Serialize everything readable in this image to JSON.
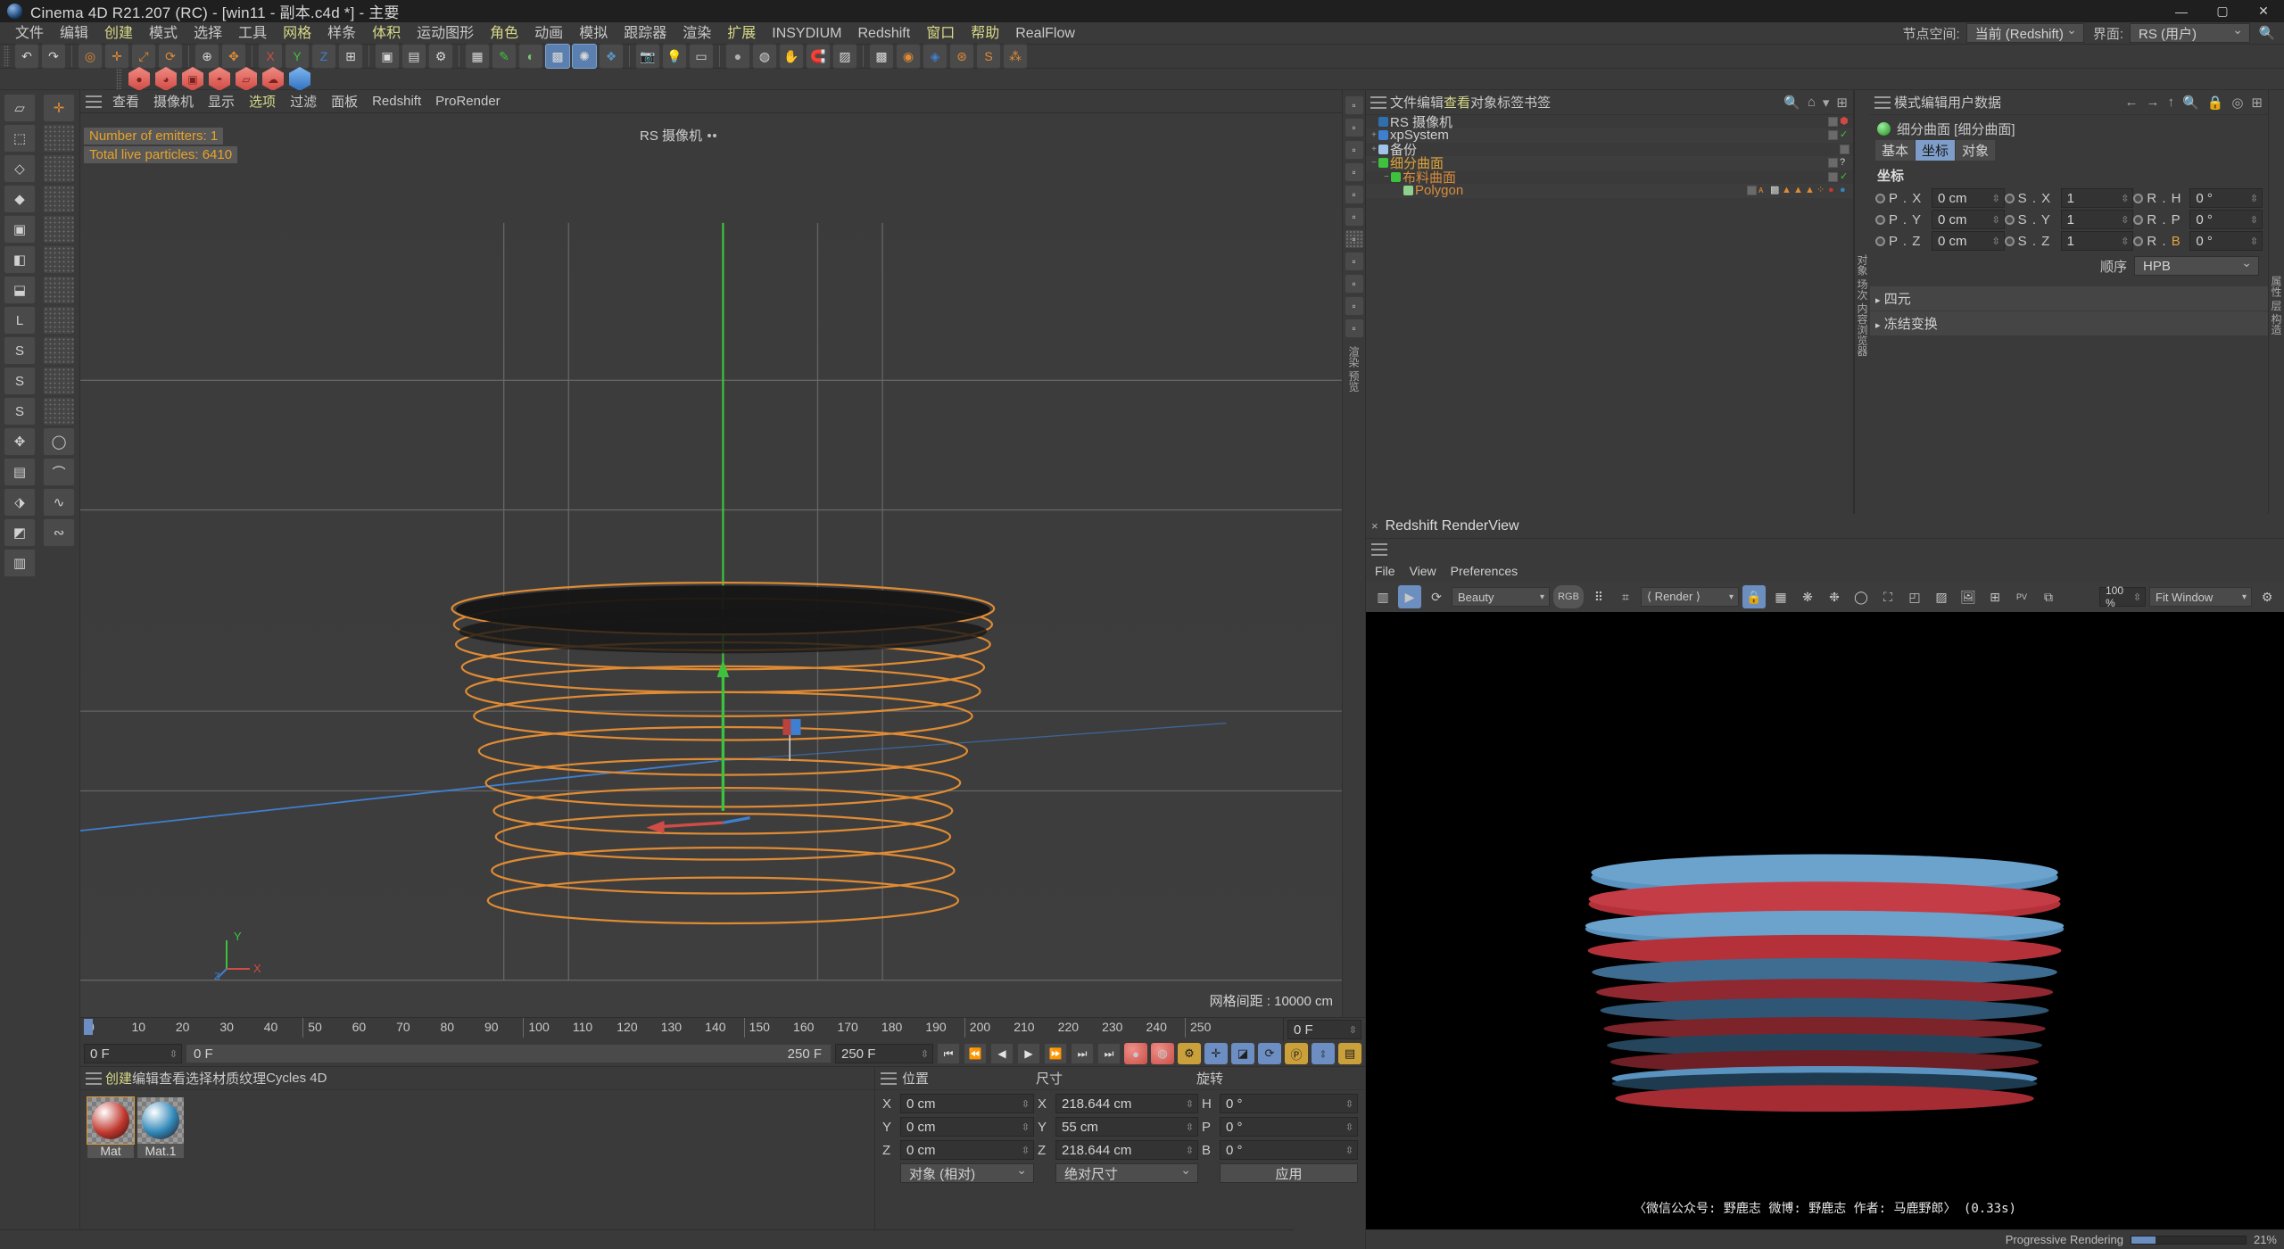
{
  "titlebar": {
    "title": "Cinema 4D R21.207 (RC) - [win11 - 副本.c4d *] - 主要",
    "minimize": "—",
    "maximize": "▢",
    "close": "✕"
  },
  "menubar": {
    "items": [
      {
        "label": "文件",
        "hl": false
      },
      {
        "label": "编辑",
        "hl": false
      },
      {
        "label": "创建",
        "hl": true
      },
      {
        "label": "模式",
        "hl": false
      },
      {
        "label": "选择",
        "hl": false
      },
      {
        "label": "工具",
        "hl": false
      },
      {
        "label": "网格",
        "hl": true
      },
      {
        "label": "样条",
        "hl": false
      },
      {
        "label": "体积",
        "hl": true
      },
      {
        "label": "运动图形",
        "hl": false
      },
      {
        "label": "角色",
        "hl": true
      },
      {
        "label": "动画",
        "hl": false
      },
      {
        "label": "模拟",
        "hl": false
      },
      {
        "label": "跟踪器",
        "hl": false
      },
      {
        "label": "渲染",
        "hl": false
      },
      {
        "label": "扩展",
        "hl": true
      },
      {
        "label": "INSYDIUM",
        "hl": false
      },
      {
        "label": "Redshift",
        "hl": false
      },
      {
        "label": "窗口",
        "hl": true
      },
      {
        "label": "帮助",
        "hl": true
      },
      {
        "label": "RealFlow",
        "hl": false
      }
    ],
    "nodespace_label": "节点空间:",
    "nodespace_value": "当前 (Redshift)",
    "interface_label": "界面:",
    "interface_value": "RS (用户)",
    "search_icon": "search-icon"
  },
  "viewport": {
    "menu": [
      "查看",
      "摄像机",
      "显示",
      "选项",
      "过滤",
      "面板",
      "Redshift",
      "ProRender"
    ],
    "menu_hl_index": 3,
    "camera_label": "RS 摄像机",
    "overlay": [
      "Number of emitters: 1",
      "Total live particles: 6410"
    ],
    "overlay_color": "#e8a22a",
    "grid_spacing": "网格间距 : 10000 cm",
    "axis_y": "Y",
    "axis_x": "X",
    "axis_z": "Z",
    "sidetext": "渲染 预览"
  },
  "timeline": {
    "ticks": [
      0,
      10,
      20,
      30,
      40,
      50,
      60,
      70,
      80,
      90,
      100,
      110,
      120,
      130,
      140,
      150,
      160,
      170,
      180,
      190,
      200,
      210,
      220,
      230,
      240,
      250
    ],
    "current_frame_field": "0 F",
    "current_frame_right": "0 F",
    "secondary_field": "0 F",
    "range_end_label": "250 F",
    "range_end_field": "250 F",
    "playback": [
      "goto-start",
      "prev-key",
      "prev-frame",
      "play",
      "next-frame",
      "next-key",
      "goto-end"
    ],
    "record_buttons": [
      "record-icon",
      "autokey-icon"
    ],
    "key_toggles": [
      "key-position",
      "key-scale",
      "key-rotation",
      "key-param",
      "key-pla",
      "key-points"
    ]
  },
  "materials": {
    "menu": [
      "创建",
      "编辑",
      "查看",
      "选择",
      "材质",
      "纹理",
      "Cycles 4D"
    ],
    "items": [
      {
        "name": "Mat",
        "color": "#c1392f",
        "selected": true
      },
      {
        "name": "Mat.1",
        "color": "#2f87b8",
        "selected": false
      }
    ]
  },
  "coords": {
    "headers": {
      "position": "位置",
      "size": "尺寸",
      "rotation": "旋转"
    },
    "rows": [
      {
        "plab": "X",
        "pval": "0 cm",
        "slab": "X",
        "sval": "218.644 cm",
        "rlab": "H",
        "rval": "0 °"
      },
      {
        "plab": "Y",
        "pval": "0 cm",
        "slab": "Y",
        "sval": "55 cm",
        "rlab": "P",
        "rval": "0 °"
      },
      {
        "plab": "Z",
        "pval": "0 cm",
        "slab": "Z",
        "sval": "218.644 cm",
        "rlab": "B",
        "rval": "0 °"
      }
    ],
    "mode_relative": "对象 (相对)",
    "mode_size": "绝对尺寸",
    "apply": "应用"
  },
  "object_manager": {
    "menu": [
      "文件",
      "编辑",
      "查看",
      "对象",
      "标签",
      "书签"
    ],
    "menu_hl_index": 2,
    "icons": [
      "search-icon",
      "home-icon",
      "filter-icon",
      "add-icon"
    ],
    "sidetabs": "对象   场次   内容浏览器",
    "rows": [
      {
        "name": "RS 摄像机",
        "indent": 0,
        "twirl": "",
        "color": "#d0d0d0",
        "icon": "camera-icon",
        "tags": [
          "rs-tag"
        ]
      },
      {
        "name": "xpSystem",
        "indent": 0,
        "twirl": "+",
        "color": "#d0d0d0",
        "icon": "xp-icon",
        "tags": [
          "check"
        ]
      },
      {
        "name": "备份",
        "indent": 0,
        "twirl": "+",
        "color": "#d0d0d0",
        "icon": "null-icon",
        "tags": []
      },
      {
        "name": "细分曲面",
        "indent": 0,
        "twirl": "−",
        "color": "#e0a53a",
        "icon": "subdiv-icon",
        "tags": [
          "question"
        ]
      },
      {
        "name": "布料曲面",
        "indent": 1,
        "twirl": "−",
        "color": "#d98c3c",
        "icon": "cloth-icon",
        "tags": [
          "check"
        ]
      },
      {
        "name": "Polygon",
        "indent": 2,
        "twirl": "",
        "color": "#d98c3c",
        "icon": "poly-icon",
        "tags": [
          "xp",
          "checker",
          "tri",
          "tri",
          "tri",
          "particle",
          "mat-red",
          "mat-blue"
        ]
      }
    ]
  },
  "attributes": {
    "menu": [
      "模式",
      "编辑",
      "用户数据"
    ],
    "icons": [
      "back-arrow",
      "forward-arrow",
      "up-arrow",
      "search-icon",
      "lock-icon",
      "target-icon",
      "add-icon"
    ],
    "object_title": "细分曲面 [细分曲面]",
    "tabs": [
      "基本",
      "坐标",
      "对象"
    ],
    "active_tab": 1,
    "section": "坐标",
    "rows": [
      {
        "plab": "P . X",
        "pval": "0 cm",
        "slab": "S . X",
        "sval": "1",
        "rlab": "R . H",
        "rval": "0 °"
      },
      {
        "plab": "P . Y",
        "pval": "0 cm",
        "slab": "S . Y",
        "sval": "1",
        "rlab": "R . P",
        "rval": "0 °"
      },
      {
        "plab": "P . Z",
        "pval": "0 cm",
        "slab": "S . Z",
        "sval": "1",
        "rlab": "R . B",
        "rval": "0 °"
      }
    ],
    "order_label": "顺序",
    "order_value": "HPB",
    "collapsed": [
      "四元",
      "冻结变换"
    ],
    "sidetext": "属性 层 构造"
  },
  "renderview": {
    "title": "Redshift RenderView",
    "close": "×",
    "menu": [
      "File",
      "View",
      "Preferences"
    ],
    "aov_value": "Beauty",
    "channel_value": "RGB",
    "render_value": "⟨ Render ⟩",
    "zoom_value": "100 %",
    "fit_value": "Fit Window",
    "watermark": "〈微信公众号: 野鹿志   微博: 野鹿志   作者: 马鹿野郎〉  (0.33s)",
    "status": "Progressive Rendering",
    "progress_pct": 21
  },
  "colors": {
    "accent_orange": "#e8a22a",
    "accent_blue": "#6d8ec2",
    "panel_bg": "#3a3a3a",
    "dark_bg": "#2b2b2b",
    "render_red": "#c1392f",
    "render_blue": "#4f88b5"
  }
}
